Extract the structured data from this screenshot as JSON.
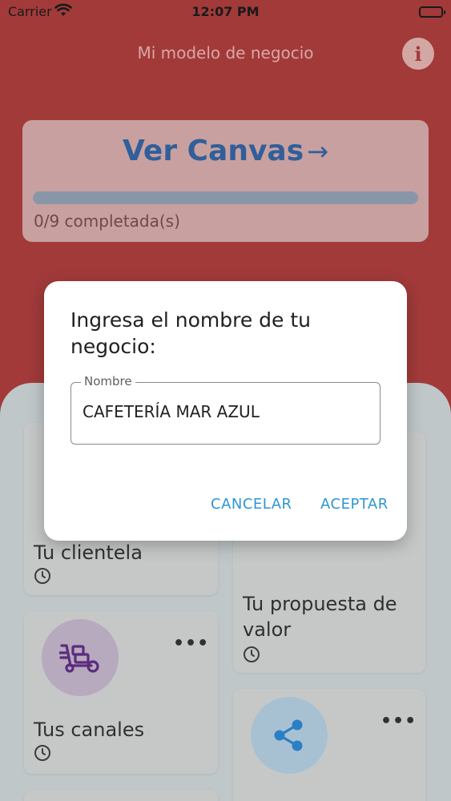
{
  "status": {
    "carrier": "Carrier",
    "time": "12:07 PM"
  },
  "header": {
    "title": "Mi modelo de negocio"
  },
  "canvas_card": {
    "link_label": "Ver Canvas",
    "progress_text": "0/9 completada(s)",
    "progress": 0
  },
  "cards": {
    "clientela": {
      "title": "Tu clientela"
    },
    "propuesta": {
      "title": "Tu propuesta de valor"
    },
    "canales": {
      "title": "Tus canales",
      "menu": "•••"
    },
    "share": {
      "menu": "•••"
    }
  },
  "dialog": {
    "title": "Ingresa el nombre de tu negocio:",
    "field_label": "Nombre",
    "field_value": "CAFETERÍA MAR AZUL",
    "cancel_label": "CANCELAR",
    "accept_label": "ACEPTAR"
  },
  "colors": {
    "header_red": "#a23a3a",
    "accent_blue": "#2e95d3",
    "canales_icon": "#5b2c7e",
    "share_icon": "#2b7fc4"
  }
}
